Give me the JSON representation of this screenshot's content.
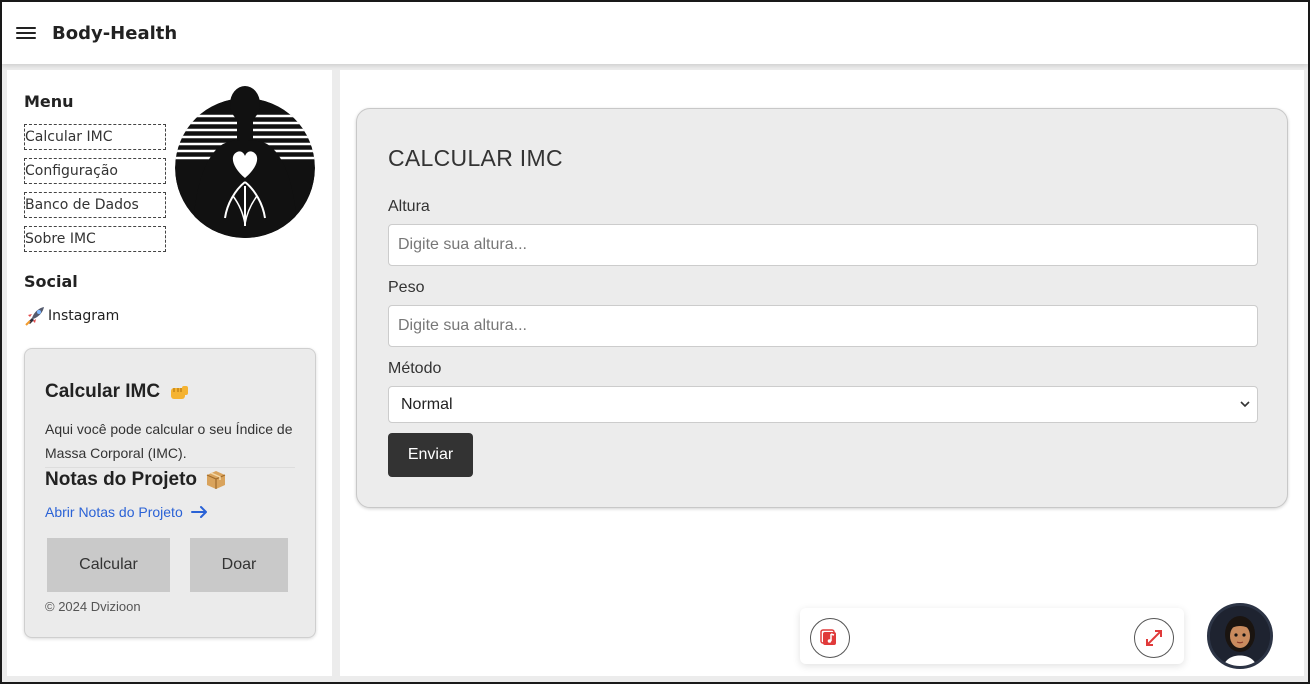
{
  "app": {
    "title": "Body-Health"
  },
  "sidebar": {
    "menu_title": "Menu",
    "items": [
      {
        "label": "Calcular IMC"
      },
      {
        "label": "Configuração"
      },
      {
        "label": "Banco de Dados"
      },
      {
        "label": "Sobre IMC"
      }
    ],
    "social_title": "Social",
    "social_link": {
      "label": "Instagram",
      "icon": "rocket-icon"
    },
    "card": {
      "title": "Calcular IMC",
      "title_icon": "fist-icon",
      "text": "Aqui você pode calcular o seu Índice de Massa Corporal (IMC).",
      "notes_title": "Notas do Projeto",
      "notes_icon": "package-icon",
      "notes_link": "Abrir Notas do Projeto",
      "calc_button": "Calcular",
      "donate_button": "Doar",
      "copyright": "© 2024 Dvizioon"
    }
  },
  "form": {
    "title": "CALCULAR IMC",
    "height_label": "Altura",
    "height_placeholder": "Digite sua altura...",
    "weight_label": "Peso",
    "weight_placeholder": "Digite sua altura...",
    "method_label": "Método",
    "method_value": "Normal",
    "submit": "Enviar"
  },
  "colors": {
    "accent_dark": "#333333",
    "link": "#2a62d6",
    "icon_red": "#e03a3a"
  }
}
